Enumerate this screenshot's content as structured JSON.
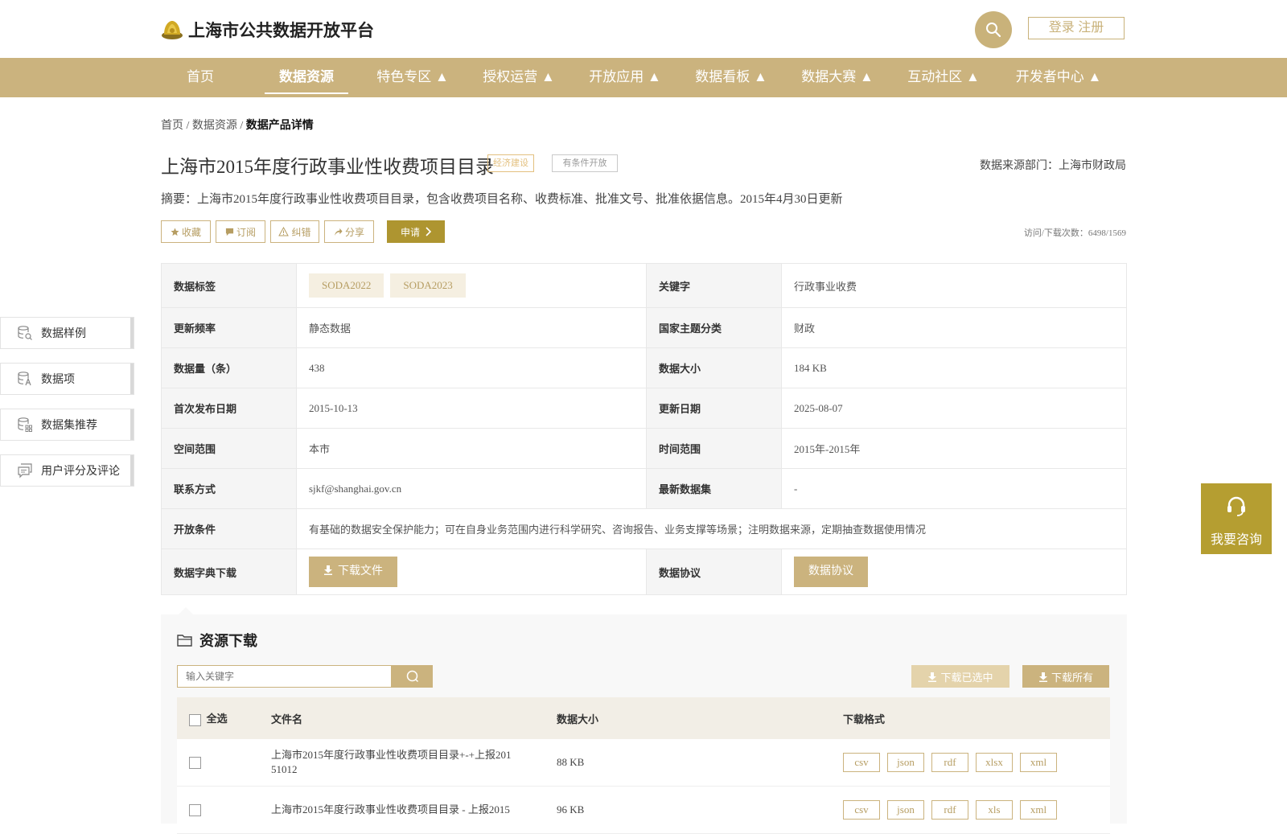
{
  "header": {
    "site_title": "上海市公共数据开放平台",
    "login_label": "登录 注册"
  },
  "nav": {
    "items": [
      {
        "label": "首页"
      },
      {
        "label": "数据资源"
      },
      {
        "label": "特色专区 ▲"
      },
      {
        "label": "授权运营 ▲"
      },
      {
        "label": "开放应用 ▲"
      },
      {
        "label": "数据看板 ▲"
      },
      {
        "label": "数据大赛 ▲"
      },
      {
        "label": "互动社区 ▲"
      },
      {
        "label": "开发者中心 ▲"
      }
    ],
    "active_index": 1
  },
  "breadcrumb": {
    "home": "首页",
    "sep1": " / ",
    "resources": "数据资源",
    "sep2": " / ",
    "current": "数据产品详情"
  },
  "dataset": {
    "title": "上海市2015年度行政事业性收费项目目录",
    "tag_category": "经济建设",
    "tag_open": "有条件开放",
    "source": "数据来源部门：上海市财政局",
    "summary": "摘要：上海市2015年度行政事业性收费项目目录，包含收费项目名称、收费标准、批准文号、批准依据信息。2015年4月30日更新",
    "visits": "访问/下载次数：6498/1569"
  },
  "actions": {
    "favorite": "收藏",
    "subscribe": "订阅",
    "correct": "纠错",
    "share": "分享",
    "apply": "申请"
  },
  "info": {
    "tags_label": "数据标签",
    "tags": [
      "SODA2022",
      "SODA2023"
    ],
    "keyword_label": "关键字",
    "keyword": "行政事业收费",
    "freq_label": "更新频率",
    "freq": "静态数据",
    "theme_label": "国家主题分类",
    "theme": "财政",
    "count_label": "数据量（条）",
    "count": "438",
    "size_label": "数据大小",
    "size": "184 KB",
    "first_pub_label": "首次发布日期",
    "first_pub": "2015-10-13",
    "updated_label": "更新日期",
    "updated": "2025-08-07",
    "space_label": "空间范围",
    "space": "本市",
    "time_label": "时间范围",
    "time": "2015年-2015年",
    "contact_label": "联系方式",
    "contact": "sjkf@shanghai.gov.cn",
    "latest_label": "最新数据集",
    "latest": "-",
    "conditions_label": "开放条件",
    "conditions": "有基础的数据安全保护能力；可在自身业务范围内进行科学研究、咨询报告、业务支撑等场景；注明数据来源，定期抽查数据使用情况",
    "dict_label": "数据字典下载",
    "dict_btn": "下载文件",
    "agreement_label": "数据协议",
    "agreement_btn": "数据协议"
  },
  "side_menu": [
    {
      "label": "数据样例",
      "icon": "db-search-icon"
    },
    {
      "label": "数据项",
      "icon": "db-text-icon"
    },
    {
      "label": "数据集推荐",
      "icon": "db-grid-icon"
    },
    {
      "label": "用户评分及评论",
      "icon": "comment-icon"
    }
  ],
  "consult": {
    "label": "我要咨询"
  },
  "resources": {
    "title": "资源下载",
    "search_placeholder": "输入关键字",
    "download_selected": "下载已选中",
    "download_all": "下载所有",
    "col_select_all": "全选",
    "col_filename": "文件名",
    "col_size": "数据大小",
    "col_format": "下载格式",
    "rows": [
      {
        "name": "上海市2015年度行政事业性收费项目目录+-+上报2015 1012",
        "name_l1": "上海市2015年度行政事业性收费项目目录+-+上报201",
        "name_l2": "51012",
        "size": "88 KB",
        "formats": [
          "csv",
          "json",
          "rdf",
          "xlsx",
          "xml"
        ]
      },
      {
        "name_l1": "上海市2015年度行政事业性收费项目目录 - 上报2015",
        "size": "96 KB",
        "formats": [
          "csv",
          "json",
          "rdf",
          "xls",
          "xml"
        ]
      }
    ]
  },
  "colors": {
    "brand": "#cbb37e",
    "apply": "#ae9530",
    "consult": "#b59e31"
  }
}
